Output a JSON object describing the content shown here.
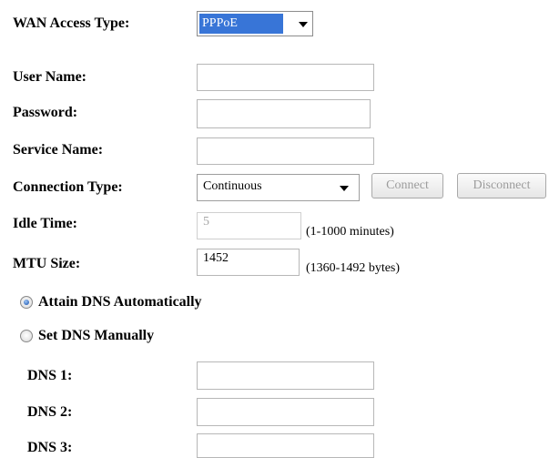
{
  "form": {
    "wan_access_type": {
      "label": "WAN Access Type:",
      "selected": "PPPoE"
    },
    "user_name": {
      "label": "User Name:",
      "value": ""
    },
    "password": {
      "label": "Password:",
      "value": ""
    },
    "service_name": {
      "label": "Service Name:",
      "value": ""
    },
    "connection_type": {
      "label": "Connection Type:",
      "selected": "Continuous",
      "connect_label": "Connect",
      "disconnect_label": "Disconnect"
    },
    "idle_time": {
      "label": "Idle Time:",
      "value": "5",
      "hint": "(1-1000 minutes)"
    },
    "mtu_size": {
      "label": "MTU Size:",
      "value": "1452",
      "hint": "(1360-1492 bytes)"
    },
    "dns_mode": {
      "auto_label": "Attain DNS Automatically",
      "manual_label": "Set DNS Manually",
      "selected": "auto"
    },
    "dns1": {
      "label": "DNS 1:",
      "value": ""
    },
    "dns2": {
      "label": "DNS 2:",
      "value": ""
    },
    "dns3": {
      "label": "DNS 3:",
      "value": ""
    }
  },
  "colors": {
    "selection_highlight": "#3875d7",
    "border": "#b7b7b7",
    "disabled_text": "#a7a7a7"
  }
}
